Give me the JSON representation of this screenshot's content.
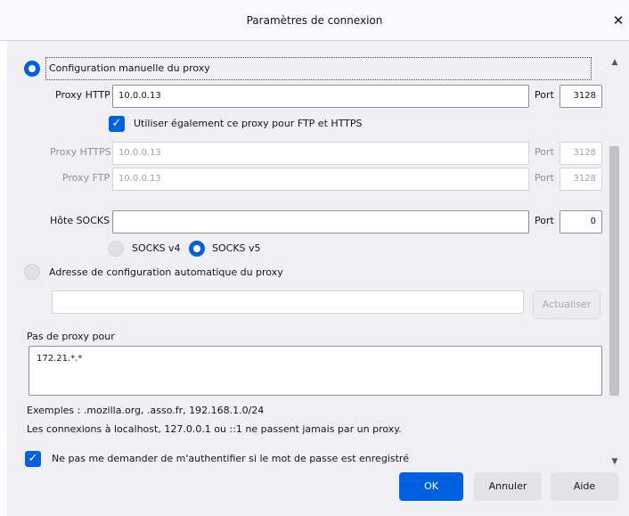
{
  "dialog": {
    "title": "Paramètres de connexion",
    "close_glyph": "✕"
  },
  "manual": {
    "radio_label": "Configuration manuelle du proxy",
    "http_label": "Proxy HTTP",
    "http_value": "10.0.0.13",
    "http_port_label": "Port",
    "http_port_value": "3128",
    "also_use_label": "Utiliser également ce proxy pour FTP et HTTPS",
    "https_label": "Proxy HTTPS",
    "https_value": "10.0.0.13",
    "https_port_label": "Port",
    "https_port_value": "3128",
    "ftp_label": "Proxy FTP",
    "ftp_value": "10.0.0.13",
    "ftp_port_label": "Port",
    "ftp_port_value": "3128",
    "socks_label": "Hôte SOCKS",
    "socks_value": "",
    "socks_port_label": "Port",
    "socks_port_value": "0",
    "socks_v4_label": "SOCKS v4",
    "socks_v5_label": "SOCKS v5"
  },
  "auto": {
    "radio_label": "Adresse de configuration automatique du proxy",
    "url_value": "",
    "reload_label": "Actualiser"
  },
  "no_proxy": {
    "label": "Pas de proxy pour",
    "value": "172.21.*.*",
    "examples": "Exemples : .mozilla.org, .asso.fr, 192.168.1.0/24",
    "localhost_note": "Les connexions à localhost, 127.0.0.1 ou ::1 ne passent jamais par un proxy."
  },
  "auth": {
    "label": "Ne pas me demander de m'authentifier si le mot de passe est enregistré"
  },
  "footer": {
    "ok": "OK",
    "cancel": "Annuler",
    "help": "Aide"
  },
  "icons": {
    "check": "✓",
    "scroll_up": "▲",
    "scroll_down": "▼"
  },
  "colors": {
    "accent": "#0061e0",
    "background": "#f0f0f4"
  }
}
